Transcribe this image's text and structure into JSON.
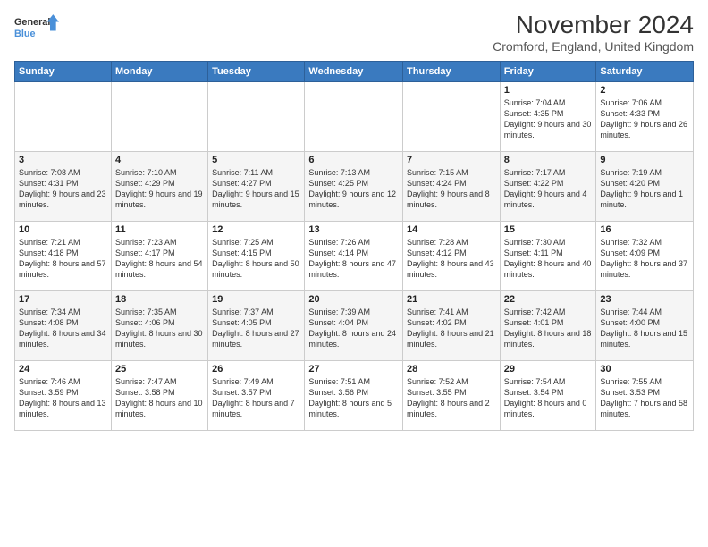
{
  "logo": {
    "line1": "General",
    "line2": "Blue"
  },
  "title": "November 2024",
  "subtitle": "Cromford, England, United Kingdom",
  "days_of_week": [
    "Sunday",
    "Monday",
    "Tuesday",
    "Wednesday",
    "Thursday",
    "Friday",
    "Saturday"
  ],
  "weeks": [
    [
      {
        "day": "",
        "info": ""
      },
      {
        "day": "",
        "info": ""
      },
      {
        "day": "",
        "info": ""
      },
      {
        "day": "",
        "info": ""
      },
      {
        "day": "",
        "info": ""
      },
      {
        "day": "1",
        "info": "Sunrise: 7:04 AM\nSunset: 4:35 PM\nDaylight: 9 hours and 30 minutes."
      },
      {
        "day": "2",
        "info": "Sunrise: 7:06 AM\nSunset: 4:33 PM\nDaylight: 9 hours and 26 minutes."
      }
    ],
    [
      {
        "day": "3",
        "info": "Sunrise: 7:08 AM\nSunset: 4:31 PM\nDaylight: 9 hours and 23 minutes."
      },
      {
        "day": "4",
        "info": "Sunrise: 7:10 AM\nSunset: 4:29 PM\nDaylight: 9 hours and 19 minutes."
      },
      {
        "day": "5",
        "info": "Sunrise: 7:11 AM\nSunset: 4:27 PM\nDaylight: 9 hours and 15 minutes."
      },
      {
        "day": "6",
        "info": "Sunrise: 7:13 AM\nSunset: 4:25 PM\nDaylight: 9 hours and 12 minutes."
      },
      {
        "day": "7",
        "info": "Sunrise: 7:15 AM\nSunset: 4:24 PM\nDaylight: 9 hours and 8 minutes."
      },
      {
        "day": "8",
        "info": "Sunrise: 7:17 AM\nSunset: 4:22 PM\nDaylight: 9 hours and 4 minutes."
      },
      {
        "day": "9",
        "info": "Sunrise: 7:19 AM\nSunset: 4:20 PM\nDaylight: 9 hours and 1 minute."
      }
    ],
    [
      {
        "day": "10",
        "info": "Sunrise: 7:21 AM\nSunset: 4:18 PM\nDaylight: 8 hours and 57 minutes."
      },
      {
        "day": "11",
        "info": "Sunrise: 7:23 AM\nSunset: 4:17 PM\nDaylight: 8 hours and 54 minutes."
      },
      {
        "day": "12",
        "info": "Sunrise: 7:25 AM\nSunset: 4:15 PM\nDaylight: 8 hours and 50 minutes."
      },
      {
        "day": "13",
        "info": "Sunrise: 7:26 AM\nSunset: 4:14 PM\nDaylight: 8 hours and 47 minutes."
      },
      {
        "day": "14",
        "info": "Sunrise: 7:28 AM\nSunset: 4:12 PM\nDaylight: 8 hours and 43 minutes."
      },
      {
        "day": "15",
        "info": "Sunrise: 7:30 AM\nSunset: 4:11 PM\nDaylight: 8 hours and 40 minutes."
      },
      {
        "day": "16",
        "info": "Sunrise: 7:32 AM\nSunset: 4:09 PM\nDaylight: 8 hours and 37 minutes."
      }
    ],
    [
      {
        "day": "17",
        "info": "Sunrise: 7:34 AM\nSunset: 4:08 PM\nDaylight: 8 hours and 34 minutes."
      },
      {
        "day": "18",
        "info": "Sunrise: 7:35 AM\nSunset: 4:06 PM\nDaylight: 8 hours and 30 minutes."
      },
      {
        "day": "19",
        "info": "Sunrise: 7:37 AM\nSunset: 4:05 PM\nDaylight: 8 hours and 27 minutes."
      },
      {
        "day": "20",
        "info": "Sunrise: 7:39 AM\nSunset: 4:04 PM\nDaylight: 8 hours and 24 minutes."
      },
      {
        "day": "21",
        "info": "Sunrise: 7:41 AM\nSunset: 4:02 PM\nDaylight: 8 hours and 21 minutes."
      },
      {
        "day": "22",
        "info": "Sunrise: 7:42 AM\nSunset: 4:01 PM\nDaylight: 8 hours and 18 minutes."
      },
      {
        "day": "23",
        "info": "Sunrise: 7:44 AM\nSunset: 4:00 PM\nDaylight: 8 hours and 15 minutes."
      }
    ],
    [
      {
        "day": "24",
        "info": "Sunrise: 7:46 AM\nSunset: 3:59 PM\nDaylight: 8 hours and 13 minutes."
      },
      {
        "day": "25",
        "info": "Sunrise: 7:47 AM\nSunset: 3:58 PM\nDaylight: 8 hours and 10 minutes."
      },
      {
        "day": "26",
        "info": "Sunrise: 7:49 AM\nSunset: 3:57 PM\nDaylight: 8 hours and 7 minutes."
      },
      {
        "day": "27",
        "info": "Sunrise: 7:51 AM\nSunset: 3:56 PM\nDaylight: 8 hours and 5 minutes."
      },
      {
        "day": "28",
        "info": "Sunrise: 7:52 AM\nSunset: 3:55 PM\nDaylight: 8 hours and 2 minutes."
      },
      {
        "day": "29",
        "info": "Sunrise: 7:54 AM\nSunset: 3:54 PM\nDaylight: 8 hours and 0 minutes."
      },
      {
        "day": "30",
        "info": "Sunrise: 7:55 AM\nSunset: 3:53 PM\nDaylight: 7 hours and 58 minutes."
      }
    ]
  ]
}
